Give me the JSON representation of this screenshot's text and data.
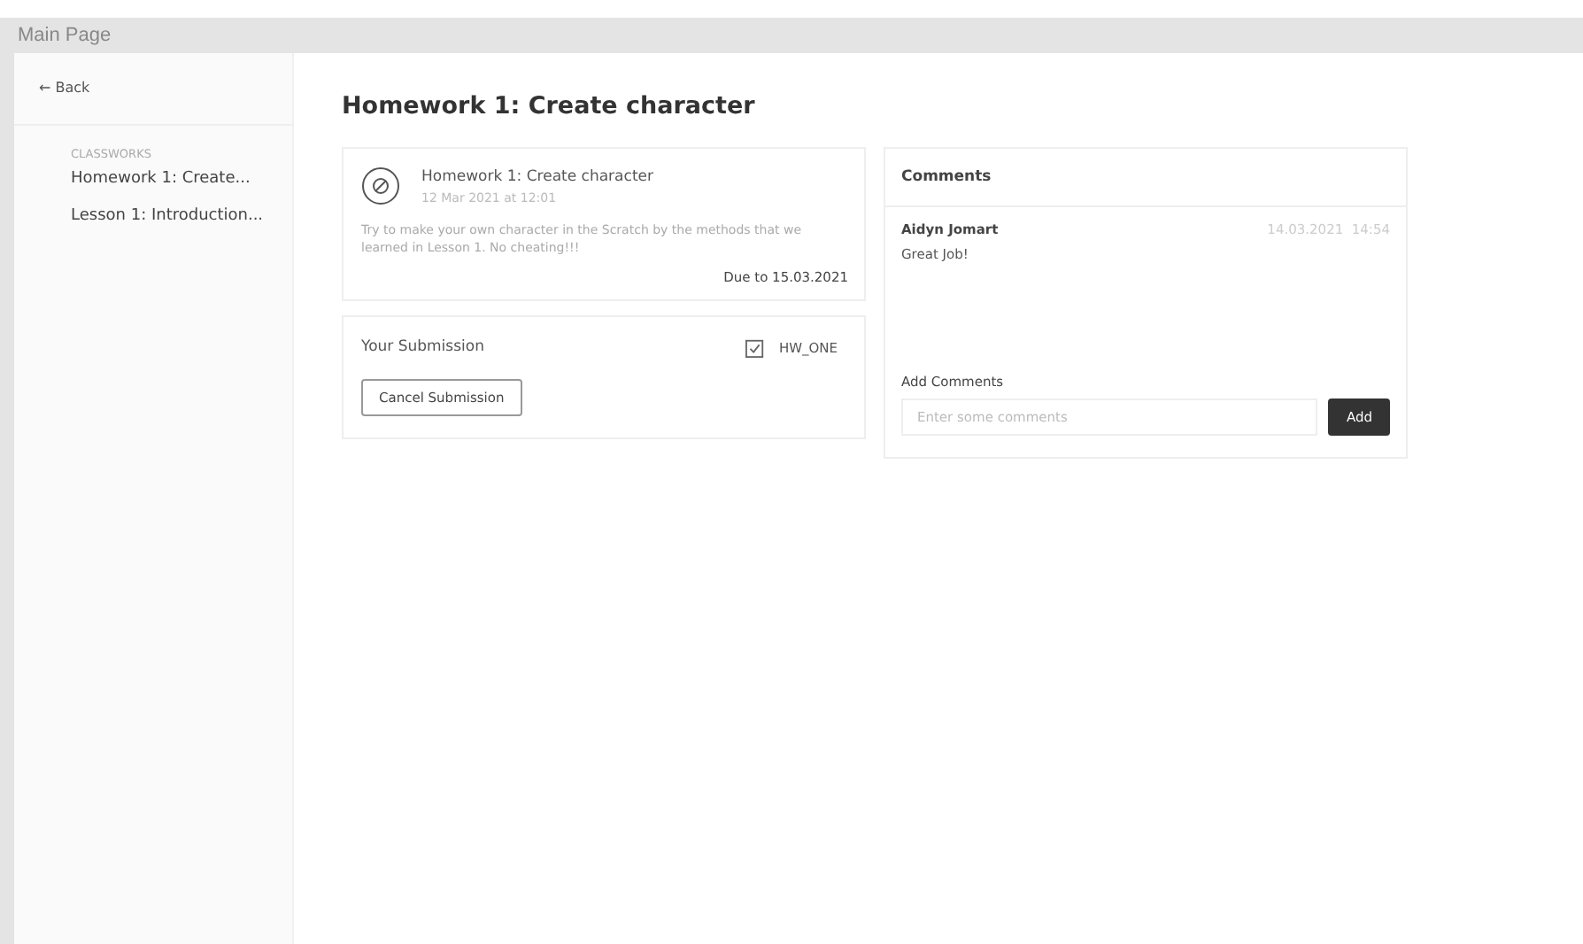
{
  "window": {
    "title": "Main Page"
  },
  "sidebar": {
    "back": {
      "arrow": "←",
      "label": "Back"
    },
    "section": "CLASSWORKS",
    "items": [
      {
        "label": "Homework 1: Create..."
      },
      {
        "label": "Lesson 1: Introduction..."
      }
    ]
  },
  "page": {
    "title": "Homework 1: Create character"
  },
  "assignment": {
    "title": "Homework 1: Create character",
    "date": "12 Mar 2021 at 12:01",
    "description": "Try to make your own character in the Scratch by the methods that we learned in Lesson 1. No cheating!!!",
    "due": "Due to 15.03.2021"
  },
  "submission": {
    "label": "Your Submission",
    "file": "HW_ONE",
    "button": "Cancel Submission"
  },
  "comments": {
    "title": "Comments",
    "items": [
      {
        "author": "Aidyn Jomart",
        "time": "14.03.2021  14:54",
        "text": "Great Job!"
      }
    ],
    "add_label": "Add Comments",
    "placeholder": "Enter some comments",
    "add_button": "Add"
  }
}
